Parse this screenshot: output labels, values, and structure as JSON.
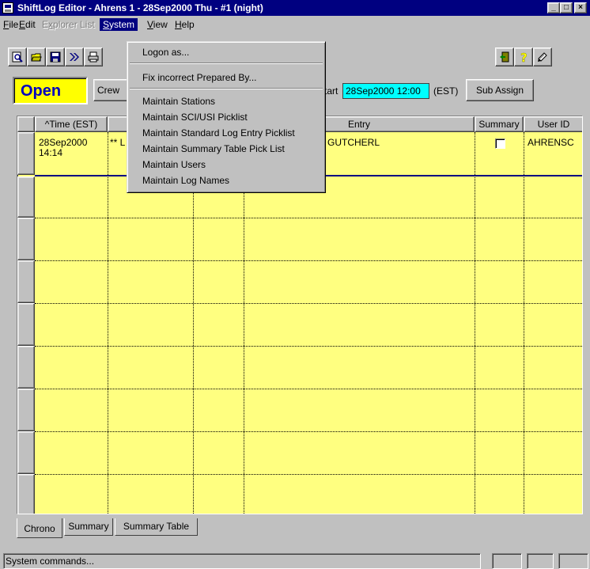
{
  "window": {
    "title": "ShiftLog Editor - Ahrens 1 - 28Sep2000 Thu - #1 (night)",
    "controls": [
      "_",
      "□",
      "×"
    ]
  },
  "menubar": [
    {
      "label": "File",
      "ul": "F",
      "rest": "ile",
      "state": "normal"
    },
    {
      "label": "Edit",
      "ul": "E",
      "rest": "dit",
      "state": "normal"
    },
    {
      "label": "Explorer List",
      "ul": "x",
      "pre": "E",
      "rest": "plorer List",
      "state": "disabled"
    },
    {
      "label": "System",
      "ul": "S",
      "rest": "ystem",
      "state": "active"
    },
    {
      "label": "View",
      "ul": "V",
      "rest": "iew",
      "state": "normal"
    },
    {
      "label": "Help",
      "ul": "H",
      "rest": "elp",
      "state": "normal"
    }
  ],
  "toolbar": {
    "icons": [
      "find-icon",
      "open-folder-icon",
      "save-icon",
      "fast-forward-icon",
      "print-icon",
      "exit-door-icon",
      "help-icon",
      "notepad-icon"
    ]
  },
  "status_row": {
    "state": "Open",
    "crew_label": "Crew",
    "start_label": "tart",
    "start_value": "28Sep2000 12:00",
    "tz_label": "(EST)",
    "sub_assign_label": "Sub Assign",
    "accent_colors": {
      "state_bg": "#ffff00",
      "state_fg": "#0000c0",
      "start_bg": "#00ffff"
    }
  },
  "grid": {
    "columns": [
      {
        "label": "^Time (EST)"
      },
      {
        "label": ""
      },
      {
        "label": ""
      },
      {
        "label": "Entry"
      },
      {
        "label": "Summary"
      },
      {
        "label": "User ID"
      }
    ],
    "rows": [
      {
        "time_date": "28Sep2000",
        "time_clock": "14:14",
        "col2": "** L",
        "entry": "GUTCHERL",
        "summary_checked": false,
        "user_id": "AHRENSC"
      }
    ],
    "empty_rows": 8,
    "bg_color": "#ffff80"
  },
  "tabs": [
    {
      "label": "Chrono",
      "active": true
    },
    {
      "label": "Summary",
      "active": false
    },
    {
      "label": "Summary Table",
      "active": false
    }
  ],
  "statusbar": {
    "text": "System commands..."
  },
  "system_menu": {
    "items": [
      {
        "label": "Logon as...",
        "type": "item"
      },
      {
        "type": "separator"
      },
      {
        "label": "Fix incorrect Prepared By...",
        "type": "item"
      },
      {
        "type": "separator"
      },
      {
        "label": "Maintain Stations",
        "type": "item"
      },
      {
        "label": "Maintain SCI/USI Picklist",
        "type": "item"
      },
      {
        "label": "Maintain Standard Log Entry Picklist",
        "type": "item"
      },
      {
        "label": "Maintain Summary Table Pick List",
        "type": "item"
      },
      {
        "label": "Maintain Users",
        "type": "item"
      },
      {
        "label": "Maintain Log Names",
        "type": "item"
      }
    ]
  }
}
